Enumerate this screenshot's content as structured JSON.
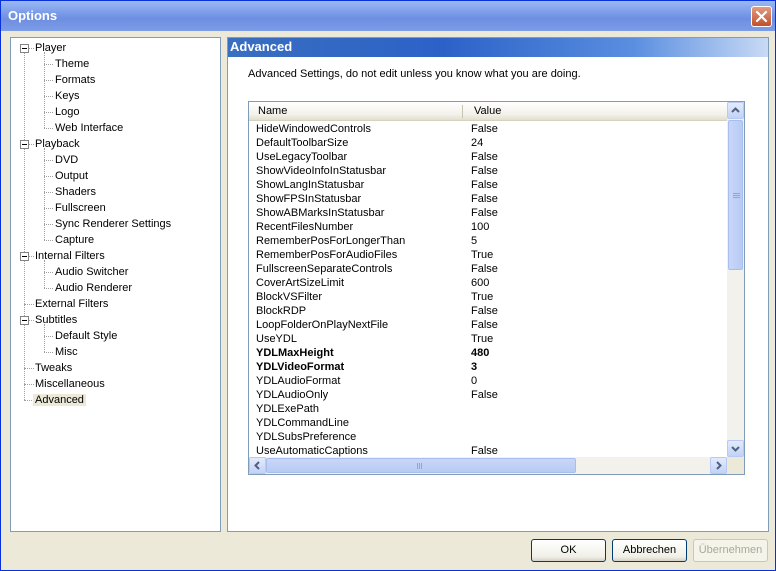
{
  "window": {
    "title": "Options"
  },
  "tree": {
    "items": [
      {
        "label": "Player"
      },
      {
        "label": "Theme"
      },
      {
        "label": "Formats"
      },
      {
        "label": "Keys"
      },
      {
        "label": "Logo"
      },
      {
        "label": "Web Interface"
      },
      {
        "label": "Playback"
      },
      {
        "label": "DVD"
      },
      {
        "label": "Output"
      },
      {
        "label": "Shaders"
      },
      {
        "label": "Fullscreen"
      },
      {
        "label": "Sync Renderer Settings"
      },
      {
        "label": "Capture"
      },
      {
        "label": "Internal Filters"
      },
      {
        "label": "Audio Switcher"
      },
      {
        "label": "Audio Renderer"
      },
      {
        "label": "External Filters"
      },
      {
        "label": "Subtitles"
      },
      {
        "label": "Default Style"
      },
      {
        "label": "Misc"
      },
      {
        "label": "Tweaks"
      },
      {
        "label": "Miscellaneous"
      },
      {
        "label": "Advanced"
      }
    ]
  },
  "section": {
    "title": "Advanced",
    "description": "Advanced Settings, do not edit unless you know what you are doing."
  },
  "list": {
    "columns": {
      "name": "Name",
      "value": "Value"
    },
    "rows": [
      {
        "name": "HideWindowedControls",
        "value": "False"
      },
      {
        "name": "DefaultToolbarSize",
        "value": "24"
      },
      {
        "name": "UseLegacyToolbar",
        "value": "False"
      },
      {
        "name": "ShowVideoInfoInStatusbar",
        "value": "False"
      },
      {
        "name": "ShowLangInStatusbar",
        "value": "False"
      },
      {
        "name": "ShowFPSInStatusbar",
        "value": "False"
      },
      {
        "name": "ShowABMarksInStatusbar",
        "value": "False"
      },
      {
        "name": "RecentFilesNumber",
        "value": "100"
      },
      {
        "name": "RememberPosForLongerThan",
        "value": "5"
      },
      {
        "name": "RememberPosForAudioFiles",
        "value": "True"
      },
      {
        "name": "FullscreenSeparateControls",
        "value": "False"
      },
      {
        "name": "CoverArtSizeLimit",
        "value": "600"
      },
      {
        "name": "BlockVSFilter",
        "value": "True"
      },
      {
        "name": "BlockRDP",
        "value": "False"
      },
      {
        "name": "LoopFolderOnPlayNextFile",
        "value": "False"
      },
      {
        "name": "UseYDL",
        "value": "True"
      },
      {
        "name": "YDLMaxHeight",
        "value": "480"
      },
      {
        "name": "YDLVideoFormat",
        "value": "3"
      },
      {
        "name": "YDLAudioFormat",
        "value": "0"
      },
      {
        "name": "YDLAudioOnly",
        "value": "False"
      },
      {
        "name": "YDLExePath",
        "value": ""
      },
      {
        "name": "YDLCommandLine",
        "value": ""
      },
      {
        "name": "YDLSubsPreference",
        "value": ""
      },
      {
        "name": "UseAutomaticCaptions",
        "value": "False"
      }
    ]
  },
  "buttons": {
    "ok": "OK",
    "cancel": "Abbrechen",
    "apply": "Übernehmen"
  },
  "colors": {
    "title_bar": "#0A246A",
    "section_header": "#2C62C8",
    "window_bg": "#ECE9D8"
  }
}
